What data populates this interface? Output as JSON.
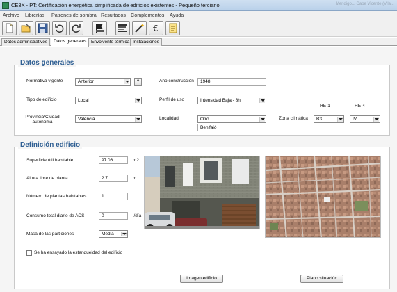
{
  "window": {
    "title": "CE3X - PT: Certificación energética simplificada de edificios existentes - Pequeño terciario",
    "right_text": "Mendigo... Cabe Vicente (Vila..."
  },
  "menu": [
    "Archivo",
    "Librerías",
    "Patrones de sombra",
    "Resultados",
    "Complementos",
    "Ayuda"
  ],
  "toolbar": {
    "buttons": [
      "new-file-icon",
      "open-file-icon",
      "save-icon",
      "undo-icon",
      "redo-icon",
      "flag-icon",
      "bar-chart-icon",
      "magic-wand-icon",
      "euro-icon",
      "report-icon"
    ]
  },
  "tabs": [
    "Datos administrativos",
    "Datos generales",
    "Envolvente térmica",
    "Instalaciones"
  ],
  "datos_generales": {
    "title": "Datos generales",
    "normativa_label": "Normativa vigente",
    "normativa_value": "Anterior",
    "help_button": "?",
    "anio_label": "Año construcción",
    "anio_value": "1948",
    "tipo_label": "Tipo de edificio",
    "tipo_value": "Local",
    "perfil_label": "Perfil de uso",
    "perfil_value": "Intensidad Baja - 8h",
    "provincia_label_1": "Provincia/Ciudad",
    "provincia_label_2": "autónoma",
    "provincia_value": "Valencia",
    "localidad_label": "Localidad",
    "localidad_value": "Otro",
    "localidad_extra": "Benifaió",
    "zona_label": "Zona climática",
    "he1_label": "HE-1",
    "he4_label": "HE-4",
    "he1_value": "B3",
    "he4_value": "IV"
  },
  "definicion": {
    "title": "Definición edificio",
    "superficie_label": "Superficie útil habitable",
    "superficie_value": "97.06",
    "superficie_unit": "m2",
    "altura_label": "Altura libre de planta",
    "altura_value": "2.7",
    "altura_unit": "m",
    "plantas_label": "Número de plantas habitables",
    "plantas_value": "1",
    "acs_label": "Consumo total diario de ACS",
    "acs_value": "0",
    "acs_unit": "l/día",
    "masa_label": "Masa de las particiones",
    "masa_value": "Media",
    "estanqueidad_label": "Se ha ensayado la estanqueidad del edificio",
    "imagen_button": "Imagen edificio",
    "plano_button": "Plano situación"
  }
}
